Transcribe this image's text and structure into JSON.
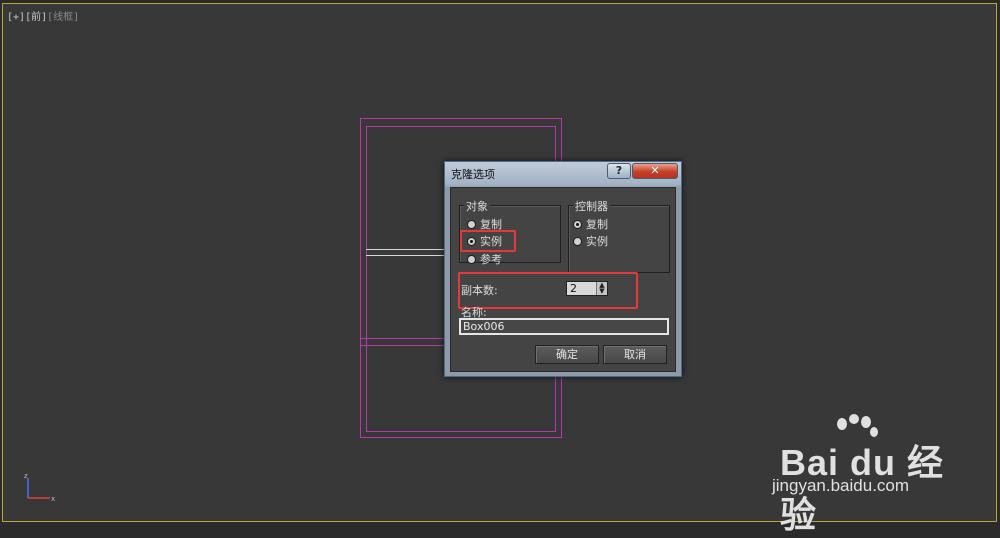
{
  "viewport": {
    "label_plus": "[+]",
    "label_view": "[前]",
    "label_mode": "[线框]"
  },
  "dialog": {
    "title": "克隆选项",
    "help_label": "?",
    "close_label": "✕",
    "object_group": {
      "title": "对象",
      "options": [
        {
          "label": "复制",
          "selected": false
        },
        {
          "label": "实例",
          "selected": true
        },
        {
          "label": "参考",
          "selected": false
        }
      ]
    },
    "controller_group": {
      "title": "控制器",
      "options": [
        {
          "label": "复制",
          "selected": true
        },
        {
          "label": "实例",
          "selected": false
        }
      ]
    },
    "copies_label": "副本数:",
    "copies_value": "2",
    "name_label": "名称:",
    "name_value": "Box006",
    "ok_label": "确定",
    "cancel_label": "取消"
  },
  "axis": {
    "z": "z",
    "x": "x"
  },
  "watermark": {
    "brand": "Bai du 经验",
    "url": "jingyan.baidu.com"
  },
  "colors": {
    "highlight": "#e23a3a",
    "wireframe": "#b33aa8",
    "viewport_border": "#b8a63a"
  }
}
